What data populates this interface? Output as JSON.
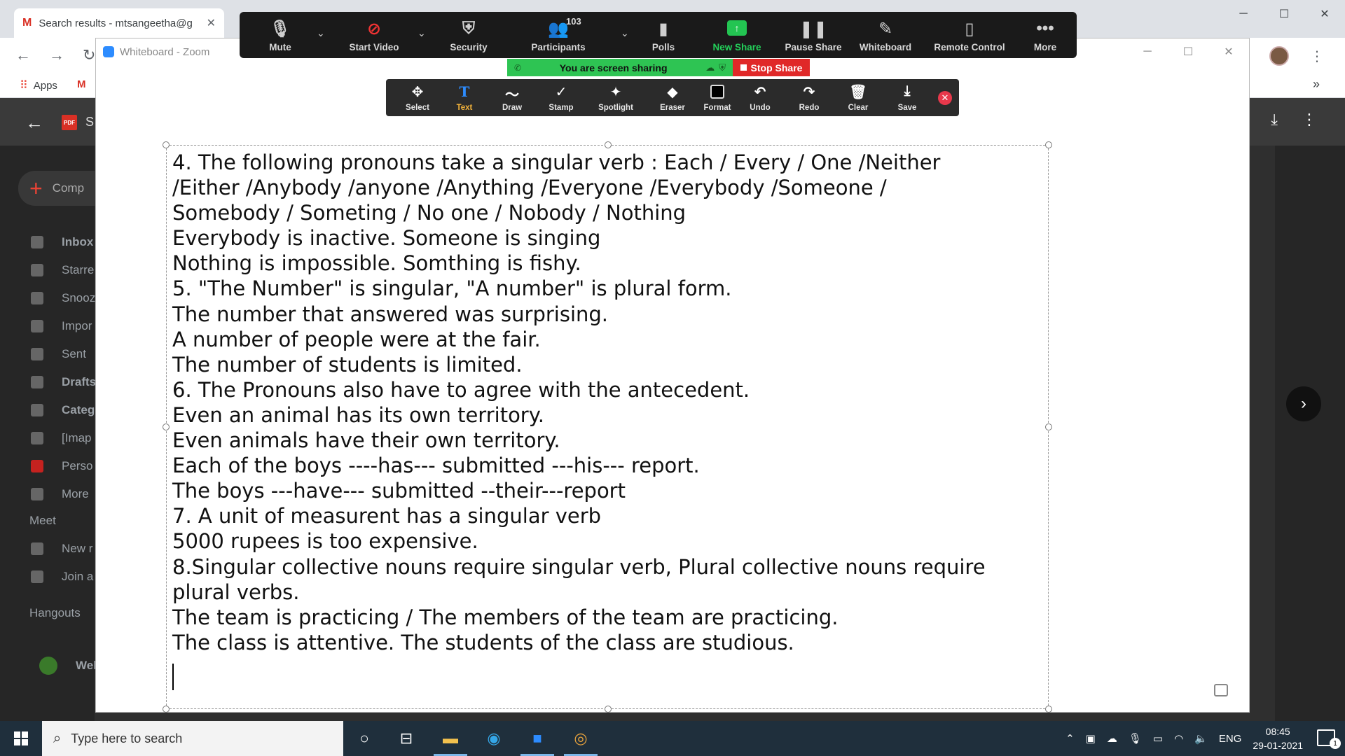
{
  "chrome": {
    "tab_title": "Search results - mtsangeetha@g",
    "bookmarks_apps": "Apps",
    "more_bookmarks": "»"
  },
  "gmail": {
    "header_title": "S",
    "compose": "Comp",
    "sidebar": [
      "Inbox",
      "Starre",
      "Snooz",
      "Impor",
      "Sent",
      "Drafts",
      "Categ",
      "[Imap",
      "Perso",
      "More"
    ],
    "meet_heading": "Meet",
    "meet_items": [
      "New r",
      "Join a"
    ],
    "hangouts_heading": "Hangouts",
    "hangouts_user": "Welc"
  },
  "zoom_window": {
    "title": "Whiteboard - Zoom"
  },
  "meeting_toolbar": {
    "mute": "Mute",
    "start_video": "Start Video",
    "security": "Security",
    "participants": "Participants",
    "participants_count": "103",
    "polls": "Polls",
    "new_share": "New Share",
    "pause_share": "Pause Share",
    "whiteboard": "Whiteboard",
    "remote_control": "Remote Control",
    "more": "More"
  },
  "sharing_banner": {
    "text": "You are screen sharing",
    "stop_share": "Stop Share"
  },
  "annotation_toolbar": {
    "select": "Select",
    "text": "Text",
    "draw": "Draw",
    "stamp": "Stamp",
    "spotlight": "Spotlight",
    "eraser": "Eraser",
    "format": "Format",
    "undo": "Undo",
    "redo": "Redo",
    "clear": "Clear",
    "save": "Save"
  },
  "whiteboard_lines": [
    "4. The following pronouns take a singular verb : Each / Every / One /Neither",
    "/Either /Anybody /anyone /Anything /Everyone /Everybody /Someone /",
    "Somebody / Someting / No one / Nobody / Nothing",
    "Everybody is inactive. Someone is singing",
    "Nothing is impossible. Somthing is fishy.",
    "5. \"The Number\" is singular, \"A number\" is plural form.",
    "The number that answered was surprising.",
    "A number of people were at the fair.",
    "The number of students is limited.",
    "6. The Pronouns also have to agree with the antecedent.",
    "Even an animal has its own territory.",
    "Even animals have their own territory.",
    "Each of the boys ----has--- submitted ---his--- report.",
    "The boys ---have--- submitted --their---report",
    "7. A unit of measurent has a singular verb",
    "5000 rupees is too expensive.",
    "8.Singular collective nouns require singular verb, Plural collective nouns require",
    "plural verbs.",
    "The team is practicing / The members of the team are practicing.",
    "The class is attentive. The students of the class are studious."
  ],
  "taskbar": {
    "search_placeholder": "Type here to search",
    "language": "ENG",
    "time": "08:45",
    "date": "29-01-2021",
    "notification_count": "1"
  }
}
